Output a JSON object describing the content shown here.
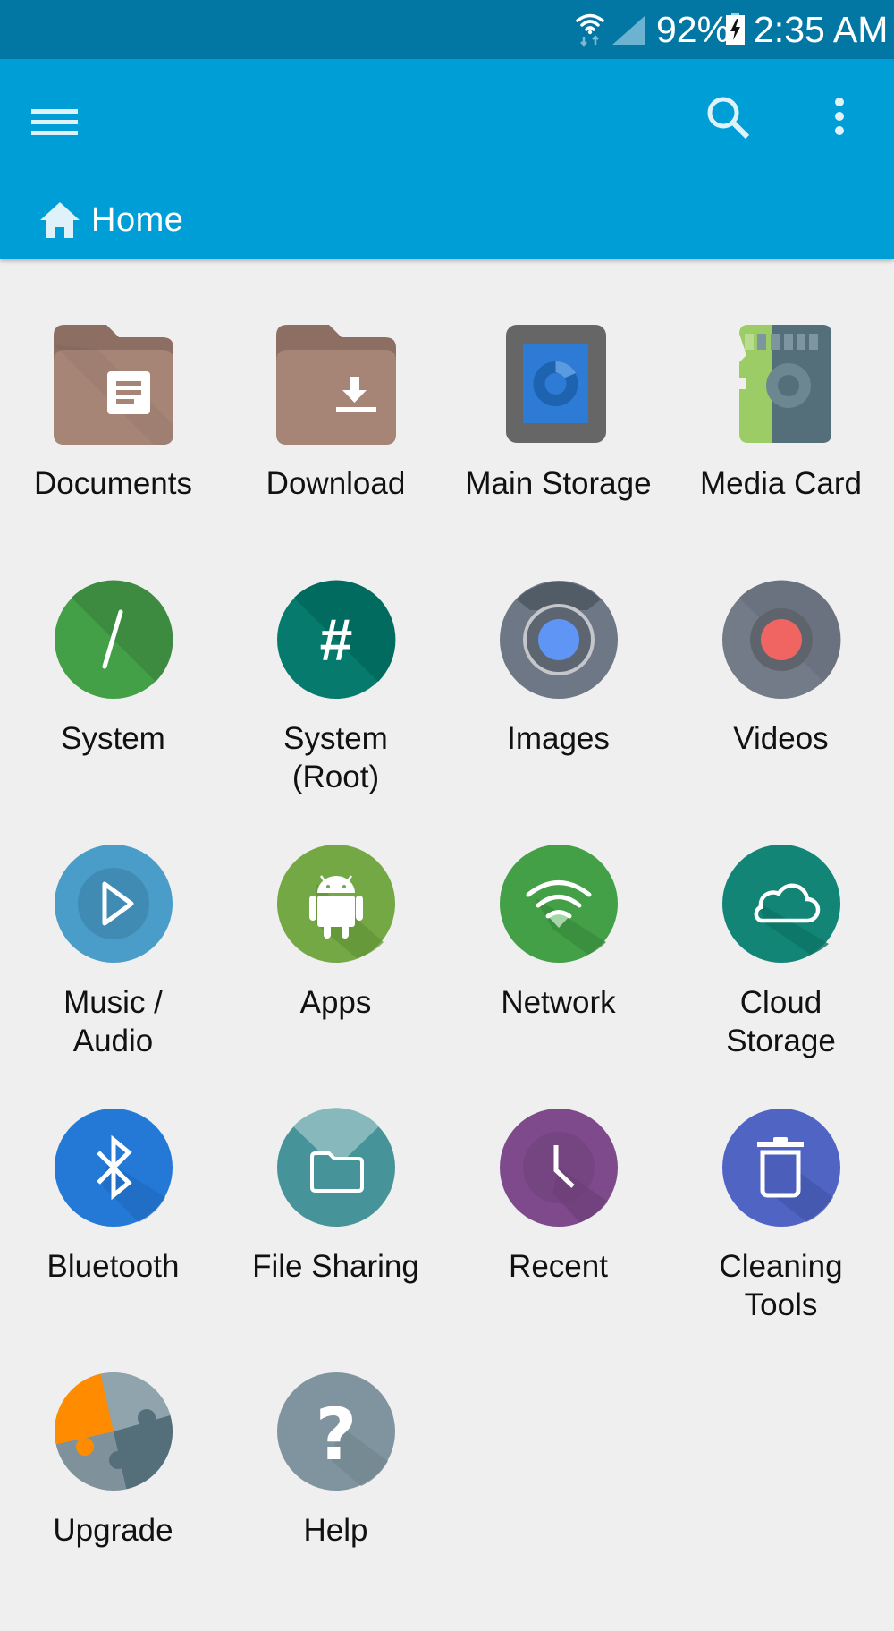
{
  "status_bar": {
    "wifi_icon": "wifi-data-icon",
    "signal_icon": "cell-signal-icon",
    "battery_percent": "92%",
    "battery_icon": "battery-charging-icon",
    "time": "2:35 AM"
  },
  "app_bar": {
    "menu_icon": "hamburger-menu-icon",
    "search_icon": "search-icon",
    "more_icon": "more-vert-icon",
    "breadcrumb": {
      "icon": "home-icon",
      "label": "Home"
    }
  },
  "colors": {
    "status_bar": "#0277a4",
    "app_bar": "#009ed6",
    "background": "#efefef"
  },
  "locations": [
    {
      "label": "Documents",
      "icon": "documents-folder-icon",
      "color": "#a4857a"
    },
    {
      "label": "Download",
      "icon": "download-folder-icon",
      "color": "#a4857a"
    },
    {
      "label": "Main Storage",
      "icon": "main-storage-icon",
      "color": "#2979d6"
    },
    {
      "label": "Media Card",
      "icon": "sd-card-icon",
      "color": "#9ccc65"
    },
    {
      "label": "System",
      "icon": "system-slash-icon",
      "color": "#43a047"
    },
    {
      "label": "System\n(Root)",
      "icon": "root-hash-icon",
      "color": "#00796b"
    },
    {
      "label": "Images",
      "icon": "camera-lens-icon",
      "color": "#6b7684"
    },
    {
      "label": "Videos",
      "icon": "video-record-icon",
      "color": "#6b7684"
    },
    {
      "label": "Music /\nAudio",
      "icon": "play-icon",
      "color": "#4a9dc8"
    },
    {
      "label": "Apps",
      "icon": "android-icon",
      "color": "#73a844"
    },
    {
      "label": "Network",
      "icon": "wifi-network-icon",
      "color": "#43a047"
    },
    {
      "label": "Cloud\nStorage",
      "icon": "cloud-icon",
      "color": "#128576"
    },
    {
      "label": "Bluetooth",
      "icon": "bluetooth-icon",
      "color": "#2479d6"
    },
    {
      "label": "File Sharing",
      "icon": "file-sharing-folder-icon",
      "color": "#46939a"
    },
    {
      "label": "Recent",
      "icon": "clock-icon",
      "color": "#7e4a8c"
    },
    {
      "label": "Cleaning\nTools",
      "icon": "trash-icon",
      "color": "#5064c4"
    },
    {
      "label": "Upgrade",
      "icon": "puzzle-icon",
      "color": "#ff8c00"
    },
    {
      "label": "Help",
      "icon": "help-icon",
      "color": "#7f949e"
    }
  ]
}
